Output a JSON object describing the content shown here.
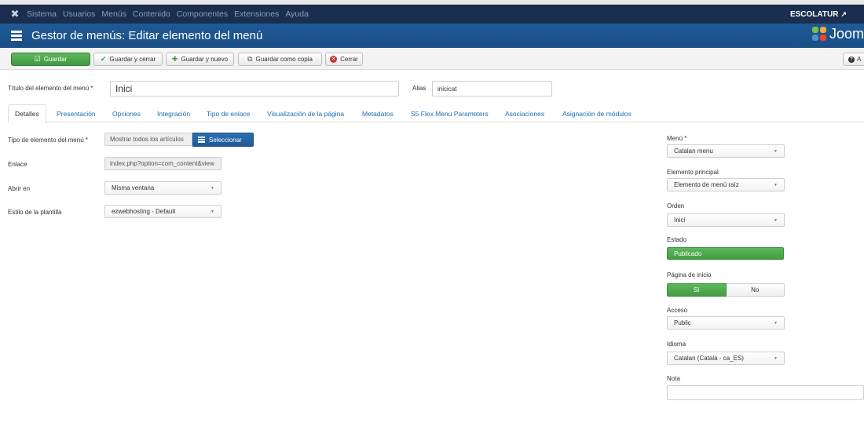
{
  "navbar": {
    "items": [
      "Sistema",
      "Usuarios",
      "Menús",
      "Contenido",
      "Componentes",
      "Extensiones",
      "Ayuda"
    ],
    "site_name": "ESCOLATUR"
  },
  "header": {
    "title": "Gestor de menús: Editar elemento del menú",
    "brand": "Joom"
  },
  "toolbar": {
    "save": "Guardar",
    "save_close": "Guardar y cerrar",
    "save_new": "Guardar y nuevo",
    "save_copy": "Guardar como copia",
    "close": "Cerrar",
    "help": "A"
  },
  "form": {
    "title_label": "Título del elemento del menú *",
    "title_value": "Inici",
    "alias_label": "Alias",
    "alias_value": "inicicat"
  },
  "tabs": [
    "Detalles",
    "Presentación",
    "Opciones",
    "Integración",
    "Tipo de enlace",
    "Visualización de la página",
    "Metadatos",
    "S5 Flex Menu Parameters",
    "Asociaciones",
    "Asignación de módulos"
  ],
  "details": {
    "type_label": "Tipo de elemento del menú *",
    "type_value": "Mostrar todos los artículos",
    "select_button": "Seleccionar",
    "link_label": "Enlace",
    "link_value": "index.php?option=com_content&view",
    "open_label": "Abrir en",
    "open_value": "Misma ventana",
    "style_label": "Estilo de la plantilla",
    "style_value": "ezwebhosting - Default"
  },
  "sidebar": {
    "menu_label": "Menú *",
    "menu_value": "Catalan menu",
    "parent_label": "Elemento principal",
    "parent_value": "Elemento de menú raíz",
    "order_label": "Orden",
    "order_value": "Inici",
    "status_label": "Estado",
    "status_value": "Publicado",
    "home_label": "Página de inicio",
    "home_yes": "Sí",
    "home_no": "No",
    "access_label": "Acceso",
    "access_value": "Public",
    "language_label": "Idioma",
    "language_value": "Catalan (Català - ca_ES)",
    "note_label": "Nota",
    "note_value": ""
  },
  "colors": {
    "navbar": "#1b2e4f",
    "titlebar": "#1f5a95",
    "save_green": "#46a046",
    "link_blue": "#1a6fb5"
  },
  "icons": {
    "joomla_logo": "joomla-x-icon",
    "title_icon": "list-icon",
    "external_link": "external-link-icon"
  }
}
